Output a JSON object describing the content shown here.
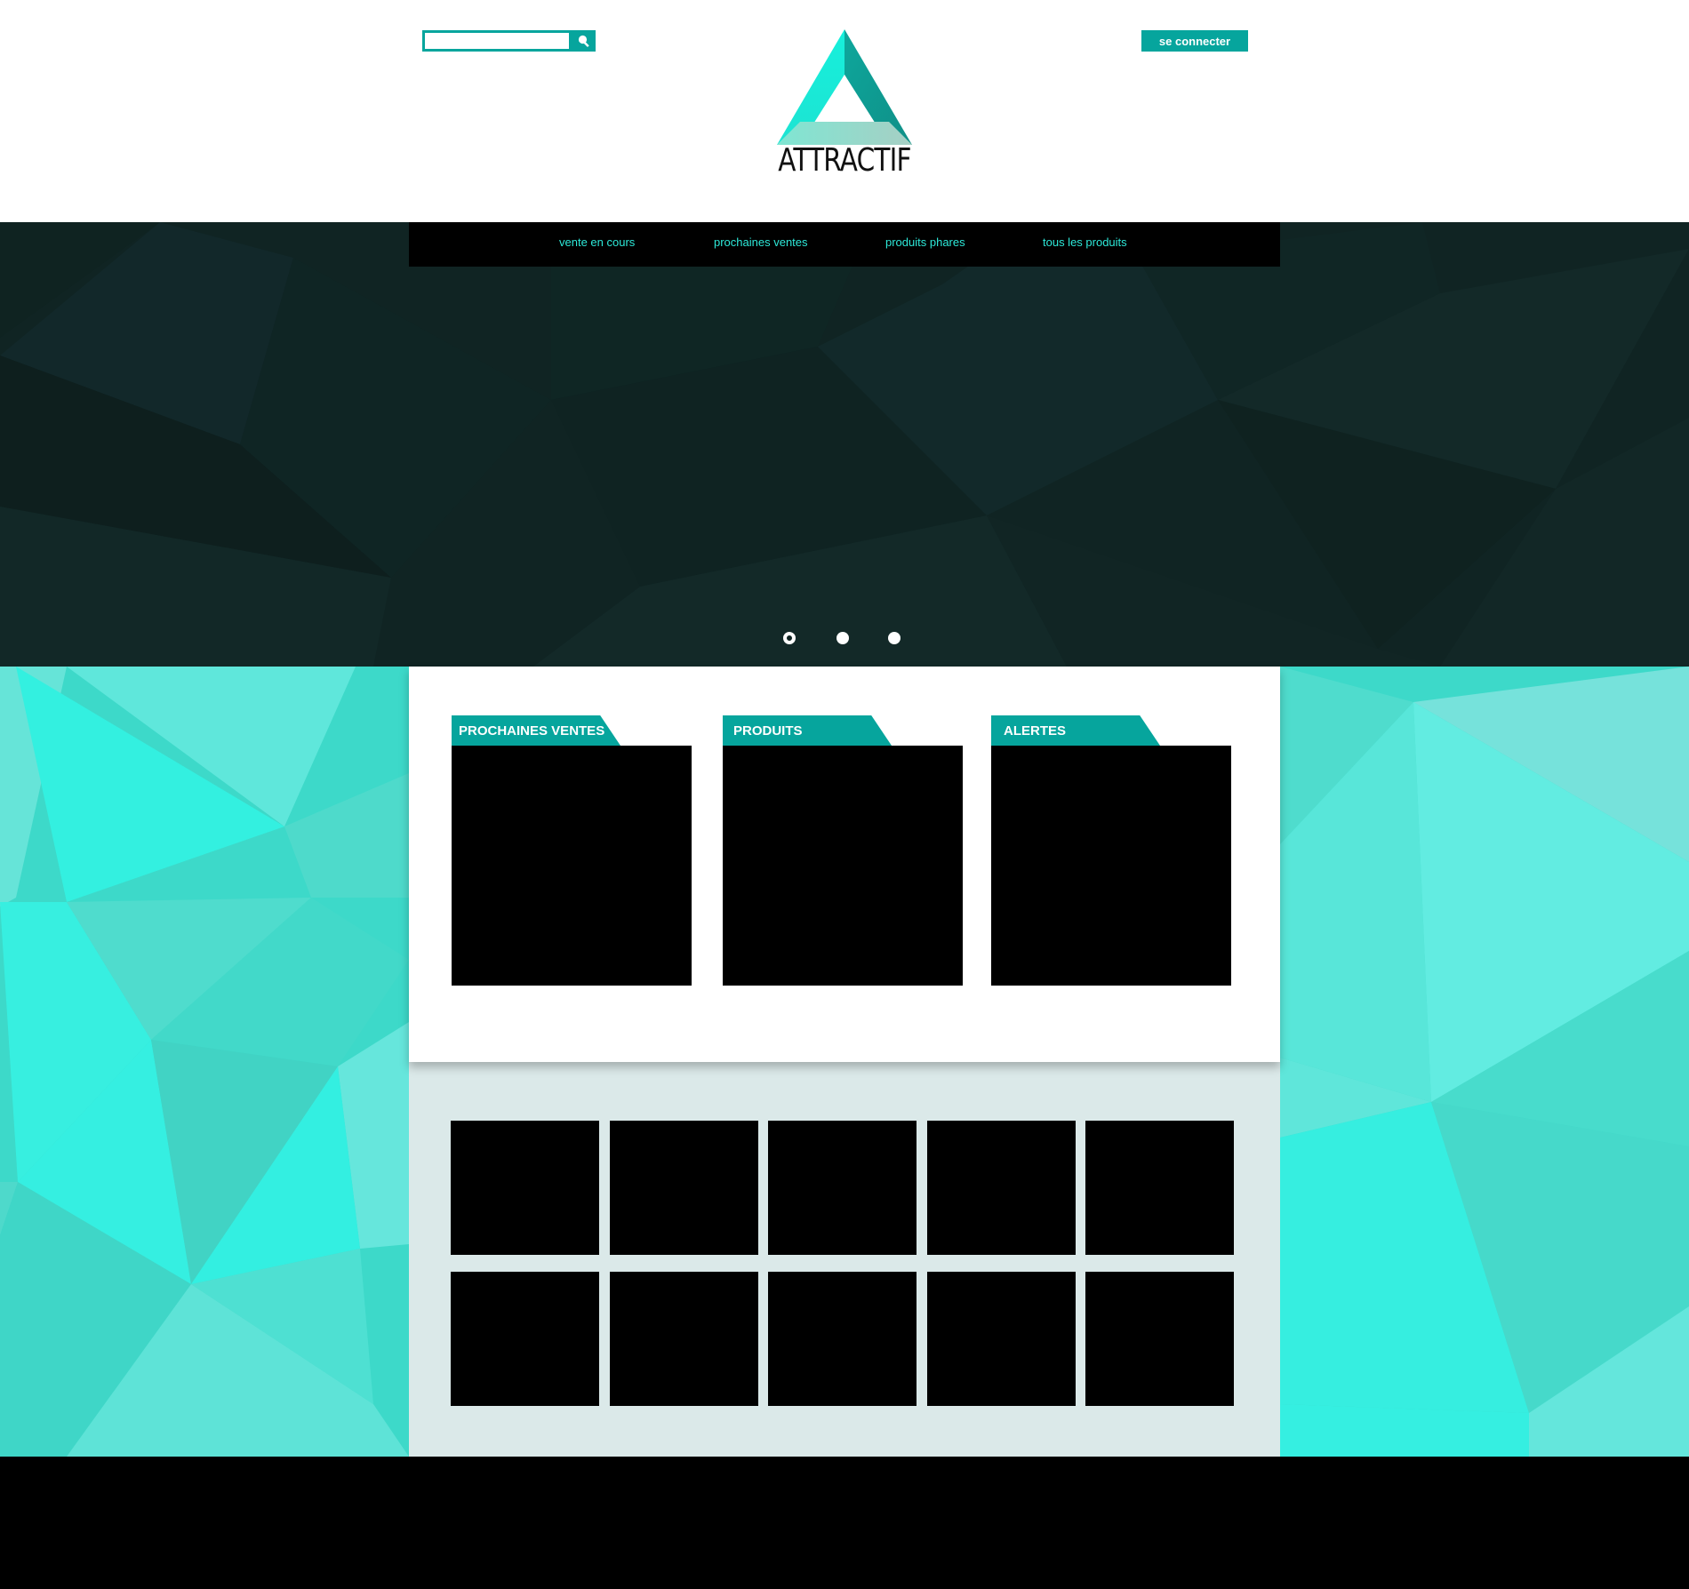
{
  "header": {
    "search": {
      "placeholder": "",
      "value": "",
      "icon": "search-icon"
    },
    "login_label": "se connecter",
    "brand_name": "ATTRACTIF"
  },
  "nav": {
    "items": [
      {
        "label": "vente en cours"
      },
      {
        "label": "prochaines ventes"
      },
      {
        "label": "produits phares"
      },
      {
        "label": "tous les produits"
      }
    ]
  },
  "carousel": {
    "slides": 3,
    "active": 1
  },
  "sections": [
    {
      "title": "PROCHAINES VENTES"
    },
    {
      "title": "PRODUITS"
    },
    {
      "title": "ALERTES"
    }
  ],
  "colors": {
    "accent": "#06a59d",
    "nav_text": "#2de8d8",
    "hero_bg": "#102423",
    "lower_bg": "#3dd9c9",
    "grid_bg": "#dbe9e9"
  }
}
